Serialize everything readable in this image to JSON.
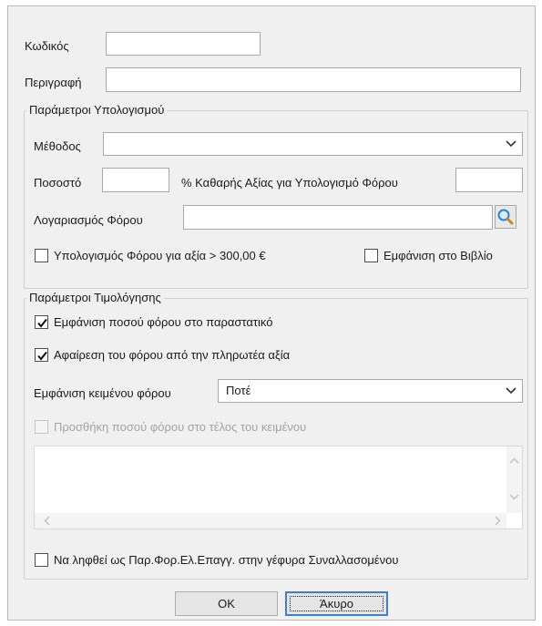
{
  "form": {
    "code_label": "Κωδικός",
    "code_value": "",
    "description_label": "Περιγραφή",
    "description_value": ""
  },
  "calc_group": {
    "title": "Παράμετροι Υπολογισμού",
    "method_label": "Μέθοδος",
    "method_value": "",
    "percent_label": "Ποσοστό",
    "percent_value": "",
    "net_value_label": "% Καθαρής Αξίας για Υπολογισμό Φόρου",
    "net_value_value": "",
    "account_label": "Λογαριασμός Φόρου",
    "account_value": "",
    "tax_over_label": "Υπολογισμός Φόρου για αξία > 300,00 €",
    "tax_over_checked": false,
    "show_in_book_label": "Εμφάνιση στο Βιβλίο",
    "show_in_book_checked": false
  },
  "invoice_group": {
    "title": "Παράμετροι Τιμολόγησης",
    "show_amount_label": "Εμφάνιση ποσού φόρου στο παραστατικό",
    "show_amount_checked": true,
    "deduct_label": "Αφαίρεση του φόρου από την πληρωτέα αξία",
    "deduct_checked": true,
    "show_text_label": "Εμφάνιση κειμένου φόρου",
    "show_text_value": "Ποτέ",
    "add_amount_label": "Προσθήκη ποσού φόρου στο τέλος του κειμένου",
    "add_amount_checked": false,
    "text_value": ""
  },
  "bridge": {
    "label": "Να ληφθεί ως Παρ.Φορ.Ελ.Επαγγ. στην γέφυρα Συναλλασομένου",
    "checked": false
  },
  "buttons": {
    "ok": "OK",
    "cancel": "Άκυρο"
  },
  "colors": {
    "dialog_bg": "#f0f0f0",
    "focus_border": "#3c7fd6",
    "search_icon_blue": "#2f7fd2"
  },
  "icons": {
    "search": "magnifier-icon",
    "dropdown": "chevron-down-icon",
    "check": "checkmark-icon"
  }
}
